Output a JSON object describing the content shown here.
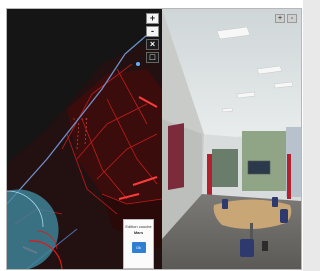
{
  "map": {
    "zoom_in": "+",
    "zoom_out": "-",
    "close": "×",
    "layers": "□",
    "popup": {
      "line1": "Edition couche",
      "mode": "Mars",
      "ok": "Ok"
    }
  },
  "panorama": {
    "zoom_in": "+",
    "zoom_out": "-"
  }
}
